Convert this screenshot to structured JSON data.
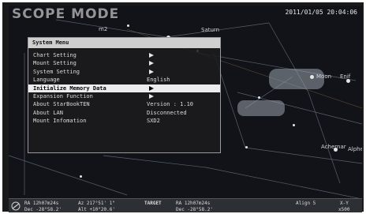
{
  "header": {
    "mode_title": "SCOPE MODE",
    "datetime": "2011/01/05 20:04:06"
  },
  "sky_labels": {
    "m2": "m2",
    "saturn": "Saturn",
    "moon": "Moon",
    "enif": "Enif",
    "alpheratz": "Alpheratz",
    "achernar": "Achernar"
  },
  "menu": {
    "title": "System Menu",
    "items": [
      {
        "label": "Chart Setting",
        "value": "",
        "arrow": true,
        "selected": false
      },
      {
        "label": "Mount Setting",
        "value": "",
        "arrow": true,
        "selected": false
      },
      {
        "label": "System Setting",
        "value": "",
        "arrow": true,
        "selected": false
      },
      {
        "label": "Language",
        "value": "English",
        "arrow": false,
        "selected": false
      },
      {
        "label": "Initialize Memory Data",
        "value": "",
        "arrow": true,
        "selected": true
      },
      {
        "label": "Expansion Function",
        "value": "",
        "arrow": true,
        "selected": false
      },
      {
        "label": "About StarBookTEN",
        "value": "Version : 1.10",
        "arrow": false,
        "selected": false
      },
      {
        "label": "About LAN",
        "value": "Disconnected",
        "arrow": false,
        "selected": false
      },
      {
        "label": "Mount Infomation",
        "value": "SXD2",
        "arrow": false,
        "selected": false
      }
    ]
  },
  "status_bar": {
    "ra": "RA  12h07m24s",
    "dec": "Dec -28°58.2'",
    "az": "Az  217°51' 1\"",
    "alt": "Alt +10°20.6'",
    "target_label": "TARGET",
    "target_ra": "RA  12h07m24s",
    "target_dec": "Dec -28°58.2'",
    "align": "Align 5",
    "zoom_top": "X-Y",
    "zoom_bottom": "x500"
  },
  "colors": {
    "sky_background": "#111318",
    "menu_highlight": "#ececec",
    "constellation_lines": "#6f7b8a"
  }
}
